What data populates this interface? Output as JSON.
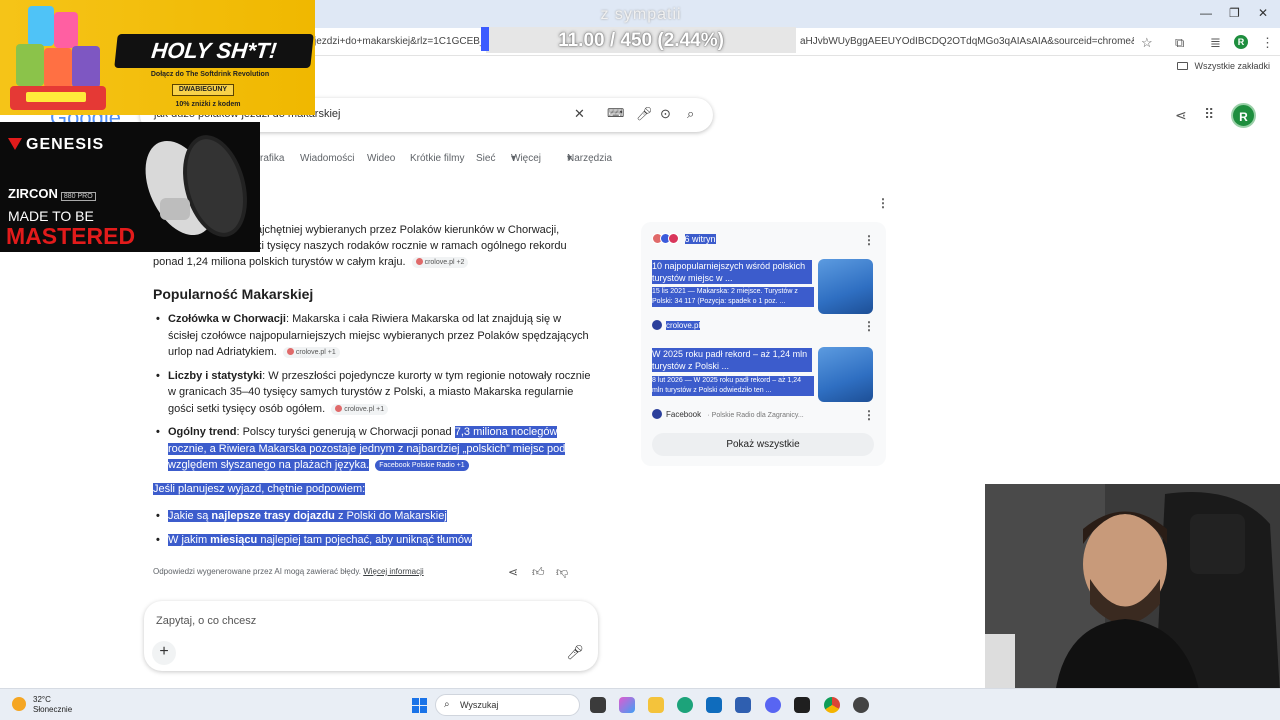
{
  "browser": {
    "url_left": "jezdzi+do+makarskiej&rlz=1C1GCEB_enP",
    "url_right": "aHJvbWUyBggAEEUYOdIBCDQ2OTdqMGo3qAIAsAIA&sourceid=chrome&sourc...",
    "bookmarks_label": "Wszystkie zakładki",
    "profile_initial": "R"
  },
  "overlay": {
    "donate_title": "z sympatii",
    "donate_count": "11.00 / 450 (2.44%)",
    "donate_progress_pct": 2.44,
    "ad1": {
      "headline": "HOLY SH*T!",
      "tagline": "Dołącz do The Softdrink Revolution",
      "code": "DWABIEGUNY",
      "discount": "10% zniżki z kodem"
    },
    "ad2": {
      "brand": "GENESIS",
      "product": "ZIRCON",
      "product_badge": "880 PRO",
      "slogan1": "MADE TO BE",
      "slogan2": "MASTERED"
    }
  },
  "search": {
    "query": "jak dużo polaków jeździ do makarskiej",
    "tabs": [
      "rafika",
      "Wiadomości",
      "Wideo",
      "Krótkie filmy",
      "Sieć",
      "Więcej",
      "Narzędzia"
    ],
    "account_initial": "R"
  },
  "ai": {
    "intro": "ajchętniej wybieranych przez Polaków kierunków w Chorwacji,\nki tysięcy naszych rodaków rocznie w ramach ogólnego rekordu\nponad 1,24 miliona polskich turystów w całym kraju.",
    "intro_cite": "crolove.pl +2",
    "heading": "Popularność Makarskiej",
    "bullets": [
      {
        "bold": "Czołówka w Chorwacji",
        "text": ": Makarska i cała Riwiera Makarska od lat znajdują się w ścisłej czołówce najpopularniejszych miejsc wybieranych przez Polaków spędzających urlop nad Adriatykiem.",
        "cite": "crolove.pl +1"
      },
      {
        "bold": "Liczby i statystyki",
        "text": ": W przeszłości pojedyncze kurorty w tym regionie notowały rocznie w granicach 35–40 tysięcy samych turystów z Polski, a miasto Makarska regularnie gości setki tysięcy osób ogółem.",
        "cite": "crolove.pl +1"
      },
      {
        "bold": "Ogólny trend",
        "text_plain": ": Polscy turyści generują w Chorwacji ponad ",
        "text_sel": "7,3 miliona noclegów rocznie, a Riwiera Makarska pozostaje jednym z najbardziej „polskich” miejsc pod względem słyszanego na plażach języka.",
        "cite": "Facebook Polskie Radio +1"
      }
    ],
    "plan_intro": "Jeśli planujesz wyjazd, chętnie podpowiem:",
    "plan_items": [
      {
        "pre": "Jakie są ",
        "bold": "najlepsze trasy dojazdu",
        "post": " z Polski do Makarskiej"
      },
      {
        "pre": "W jakim ",
        "bold": "miesiącu",
        "post": " najlepiej tam pojechać, aby uniknąć tłumów"
      }
    ],
    "disclaimer": "Odpowiedzi wygenerowane przez AI mogą zawierać błędy.",
    "disclaimer_link": "Więcej informacji",
    "ask_placeholder": "Zapytaj, o co chcesz"
  },
  "sources": {
    "count_label": "6 witryn",
    "cards": [
      {
        "title": "10 najpopularniejszych wśród polskich turystów miejsc w ...",
        "snippet": "15 lis 2021 — Makarska: 2 miejsce. Turystów z Polski: 34 117 (Pozycja: spadek o 1 poz. ...",
        "source": "crolove.pl",
        "source_extra": ""
      },
      {
        "title": "W 2025 roku padł rekord – aż 1,24 mln turystów z Polski ...",
        "snippet": "8 lut 2026 — W 2025 roku padł rekord – aż 1,24 mln turystów z Polski odwiedziło ten ...",
        "source": "Facebook",
        "source_extra": "Polskie Radio dla Zagranicy..."
      }
    ],
    "show_all": "Pokaż wszystkie"
  },
  "taskbar": {
    "temp": "32°C",
    "weather": "Słonecznie",
    "search_label": "Wyszukaj"
  }
}
